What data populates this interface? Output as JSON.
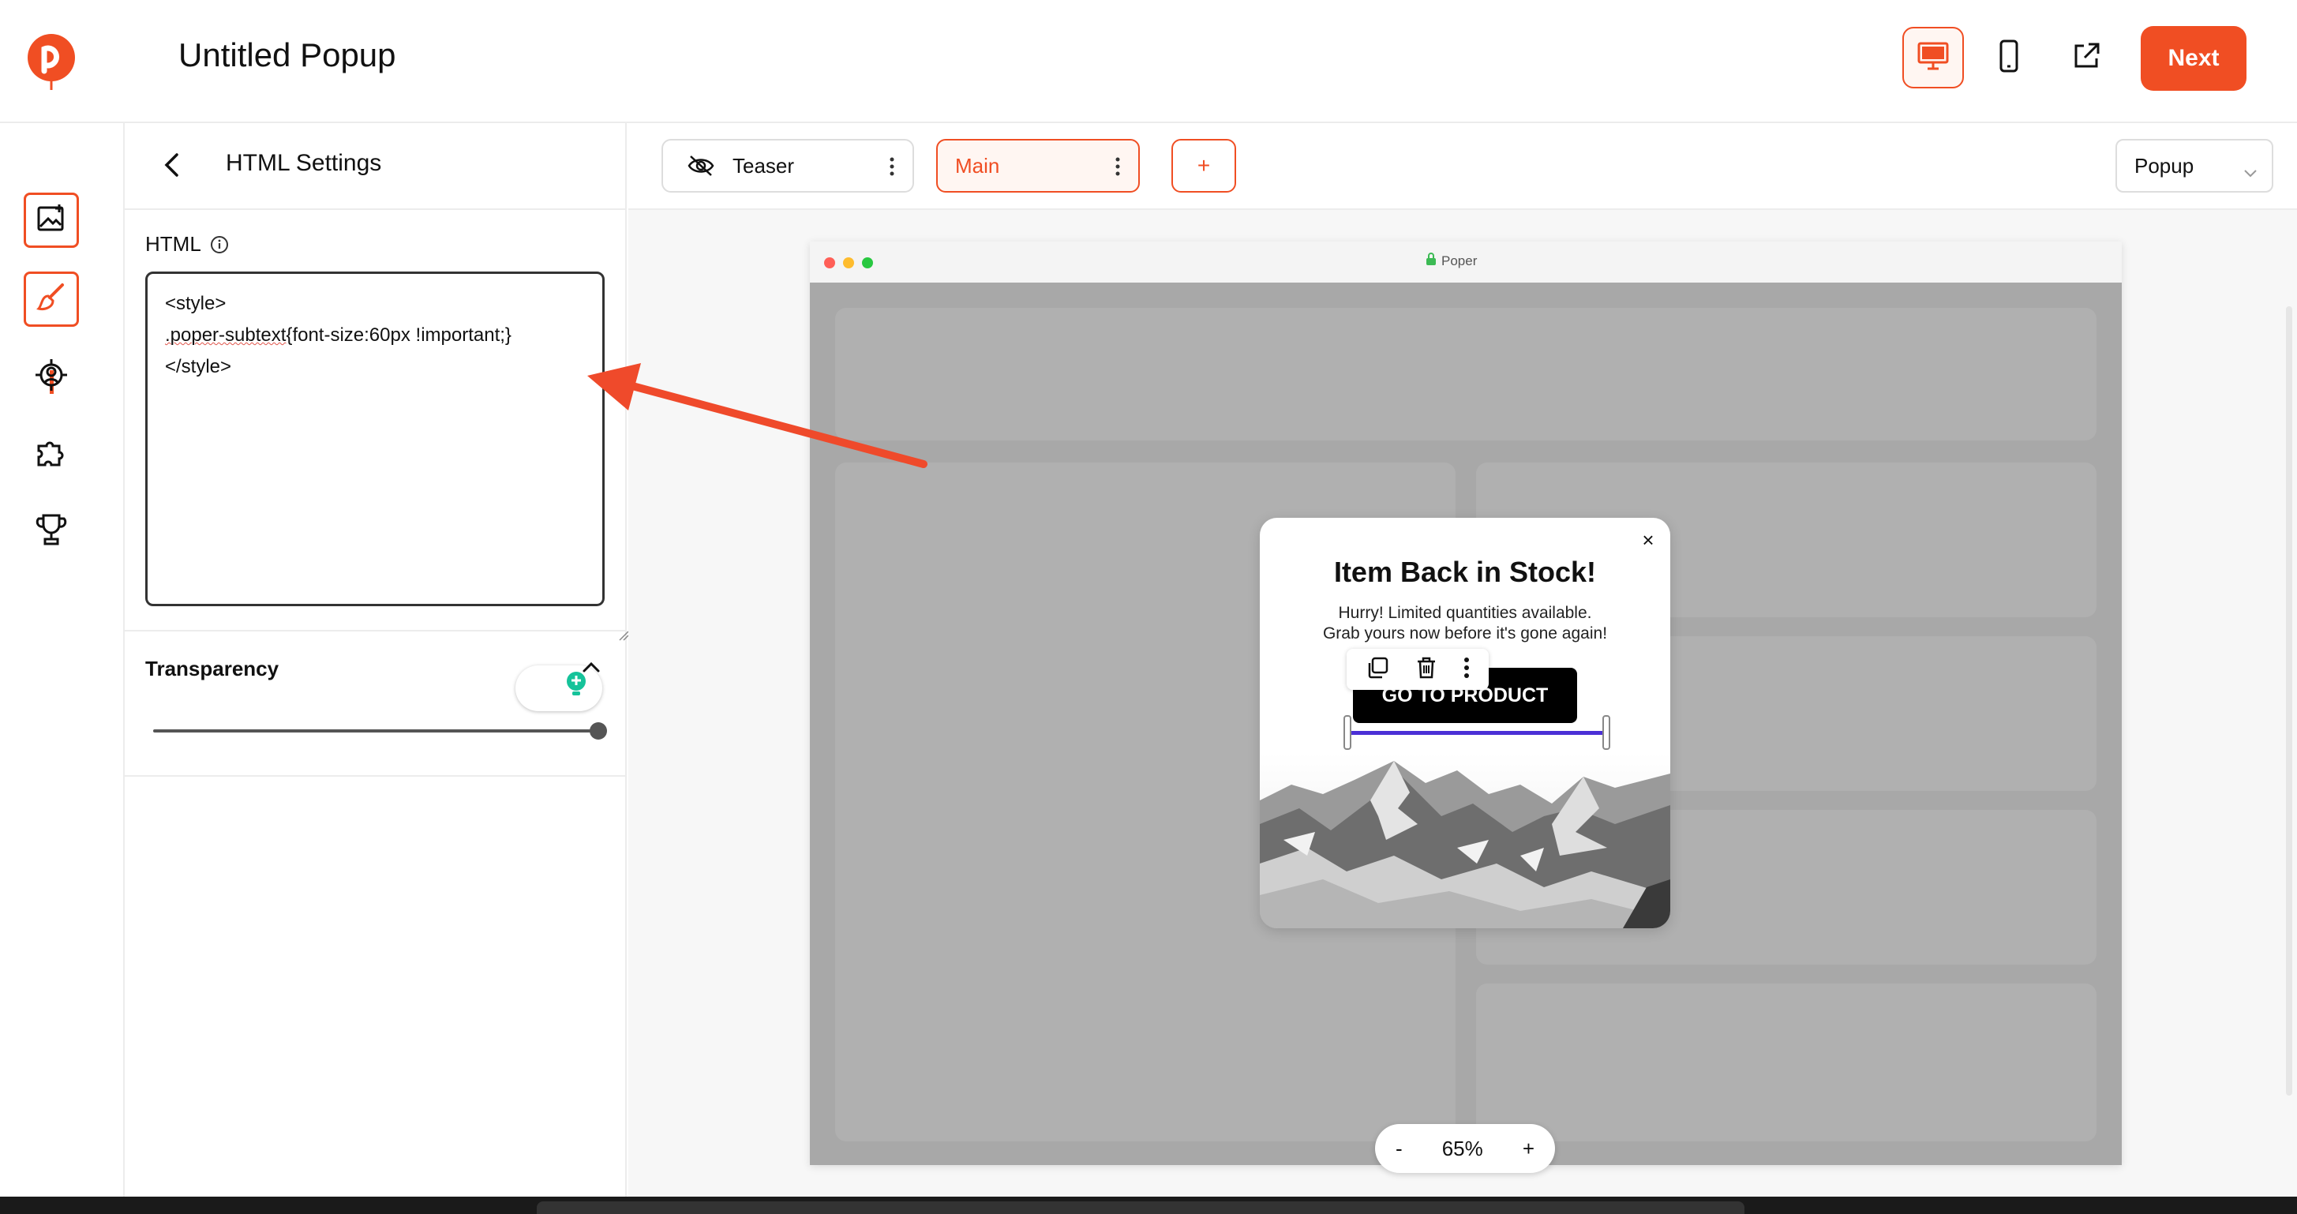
{
  "header": {
    "app_title": "Untitled Popup",
    "next_label": "Next",
    "icons": [
      "desktop-icon",
      "mobile-icon",
      "external-link-icon"
    ]
  },
  "rail": {
    "items": [
      "image-content-icon",
      "brush-icon",
      "target-icon",
      "puzzle-icon",
      "trophy-icon"
    ],
    "active": [
      "image-content-icon",
      "brush-icon"
    ]
  },
  "panel": {
    "title": "HTML Settings",
    "html_label": "HTML",
    "html_code_line1": "<style>",
    "html_code_line2_spell": ".poper-subtext",
    "html_code_line2_rest": "{font-size:60px !important;}",
    "html_code_line3": "</style>",
    "transparency_label": "Transparency",
    "transparency_value": 1.0
  },
  "canvas": {
    "tabs": [
      {
        "label": "Teaser",
        "icon": "eye-off-icon",
        "active": false
      },
      {
        "label": "Main",
        "active": true
      }
    ],
    "add_tab_label": "+",
    "type_select_value": "Popup",
    "browser_url": "Poper",
    "zoom": {
      "minus": "-",
      "value": "65%",
      "plus": "+"
    }
  },
  "popup": {
    "title": "Item Back in Stock!",
    "subtitle_line1": "Hurry! Limited quantities available.",
    "subtitle_line2": "Grab yours now before it's gone again!",
    "cta_label": "GO TO PRODUCT",
    "close_label": "×"
  },
  "colors": {
    "accent": "#f04e23",
    "selection": "#4b2fd6",
    "browser_bg": "#a8a8a8"
  }
}
